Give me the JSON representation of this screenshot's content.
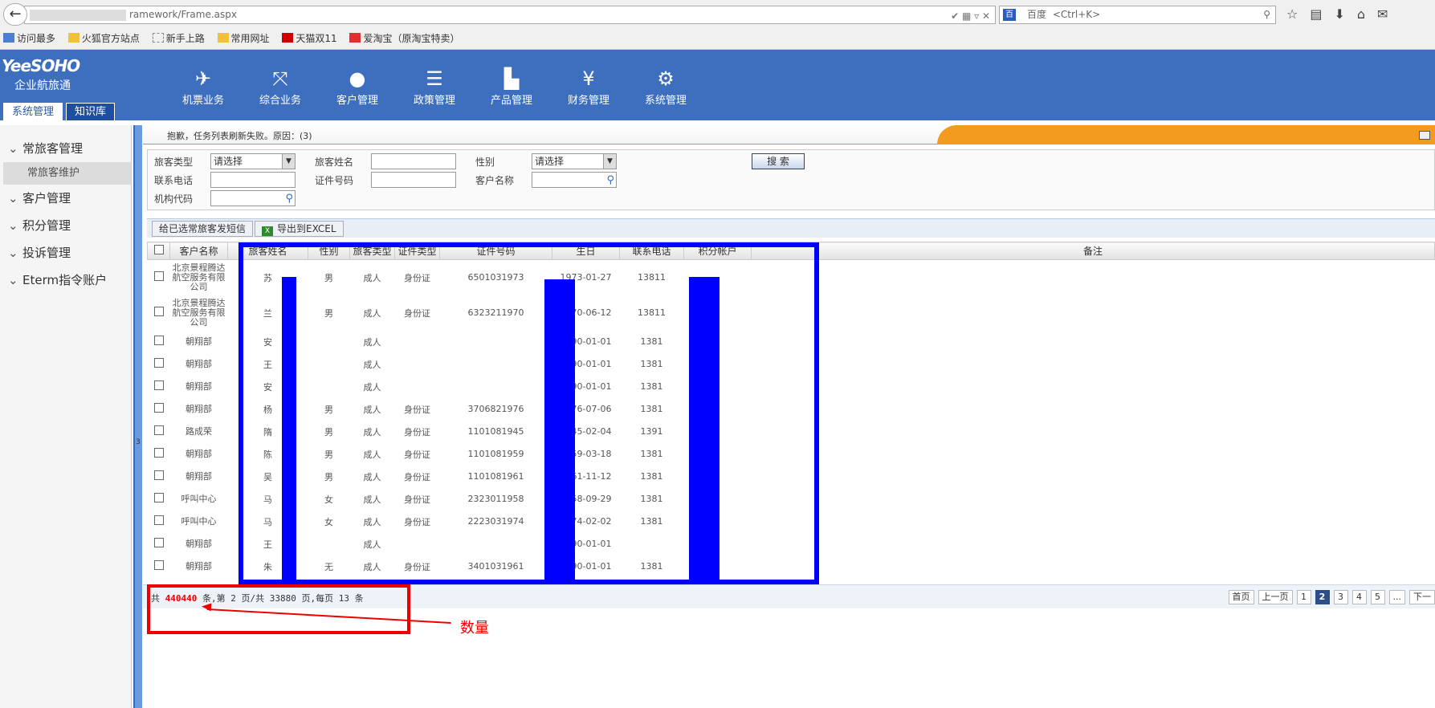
{
  "browser": {
    "url_text": "ramework/Frame.aspx",
    "search_engine": "百度",
    "search_placeholder": "<Ctrl+K>",
    "bookmarks": [
      "访问最多",
      "火狐官方站点",
      "新手上路",
      "常用网址",
      "天猫双11",
      "爱淘宝（原淘宝特卖）"
    ]
  },
  "app": {
    "brand_logo": "YeeSOHO",
    "brand_name": "企业航旅通",
    "nav": [
      {
        "label": "机票业务",
        "icon": "airplane-icon"
      },
      {
        "label": "综合业务",
        "icon": "branch-icon"
      },
      {
        "label": "客户管理",
        "icon": "user-icon"
      },
      {
        "label": "政策管理",
        "icon": "stack-icon"
      },
      {
        "label": "产品管理",
        "icon": "factory-icon"
      },
      {
        "label": "财务管理",
        "icon": "yen-icon"
      },
      {
        "label": "系统管理",
        "icon": "gear-icon"
      }
    ],
    "tabs": [
      "系统管理",
      "知识库"
    ]
  },
  "sidebar": {
    "items": [
      "常旅客管理",
      "客户管理",
      "积分管理",
      "投诉管理",
      "Eterm指令账户"
    ],
    "sub_item": "常旅客维护",
    "splitter_label": "3"
  },
  "message": "抱歉，任务列表刷新失败。原因：(3)",
  "filter": {
    "traveler_type_label": "旅客类型",
    "traveler_type_value": "请选择",
    "traveler_name_label": "旅客姓名",
    "gender_label": "性别",
    "gender_value": "请选择",
    "search_button": "搜 索",
    "phone_label": "联系电话",
    "id_number_label": "证件号码",
    "customer_name_label": "客户名称",
    "org_code_label": "机构代码"
  },
  "actions": {
    "sms_button": "给已选常旅客发短信",
    "export_button": "导出到EXCEL"
  },
  "table": {
    "headers": [
      "客户名称",
      "旅客姓名",
      "性别",
      "旅客类型",
      "证件类型",
      "证件号码",
      "生日",
      "联系电话",
      "积分帐户",
      "备注"
    ],
    "rows": [
      {
        "customer": "北京景程腾达航空服务有限公司",
        "name": "苏",
        "gender": "男",
        "type": "成人",
        "id_type": "身份证",
        "id_no": "6501031973",
        "birthday": "1973-01-27",
        "phone": "13811"
      },
      {
        "customer": "北京景程腾达航空服务有限公司",
        "name": "兰",
        "gender": "男",
        "type": "成人",
        "id_type": "身份证",
        "id_no": "6323211970",
        "birthday": "1970-06-12",
        "phone": "13811"
      },
      {
        "customer": "朝翔部",
        "name": "安",
        "gender": "",
        "type": "成人",
        "id_type": "",
        "id_no": "",
        "birthday": "1990-01-01",
        "phone": "1381"
      },
      {
        "customer": "朝翔部",
        "name": "王",
        "gender": "",
        "type": "成人",
        "id_type": "",
        "id_no": "",
        "birthday": "1990-01-01",
        "phone": "1381"
      },
      {
        "customer": "朝翔部",
        "name": "安",
        "gender": "",
        "type": "成人",
        "id_type": "",
        "id_no": "",
        "birthday": "1990-01-01",
        "phone": "1381"
      },
      {
        "customer": "朝翔部",
        "name": "杨",
        "gender": "男",
        "type": "成人",
        "id_type": "身份证",
        "id_no": "3706821976",
        "birthday": "1976-07-06",
        "phone": "1381"
      },
      {
        "customer": "路成荣",
        "name": "隋",
        "gender": "男",
        "type": "成人",
        "id_type": "身份证",
        "id_no": "1101081945",
        "birthday": "1945-02-04",
        "phone": "1391"
      },
      {
        "customer": "朝翔部",
        "name": "陈",
        "gender": "男",
        "type": "成人",
        "id_type": "身份证",
        "id_no": "1101081959",
        "birthday": "1959-03-18",
        "phone": "1381"
      },
      {
        "customer": "朝翔部",
        "name": "吴",
        "gender": "男",
        "type": "成人",
        "id_type": "身份证",
        "id_no": "1101081961",
        "birthday": "1961-11-12",
        "phone": "1381"
      },
      {
        "customer": "呼叫中心",
        "name": "马",
        "gender": "女",
        "type": "成人",
        "id_type": "身份证",
        "id_no": "2323011958",
        "birthday": "1958-09-29",
        "phone": "1381"
      },
      {
        "customer": "呼叫中心",
        "name": "马",
        "gender": "女",
        "type": "成人",
        "id_type": "身份证",
        "id_no": "2223031974",
        "birthday": "1974-02-02",
        "phone": "1381"
      },
      {
        "customer": "朝翔部",
        "name": "王",
        "gender": "",
        "type": "成人",
        "id_type": "",
        "id_no": "",
        "birthday": "1990-01-01",
        "phone": ""
      },
      {
        "customer": "朝翔部",
        "name": "朱",
        "gender": "无",
        "type": "成人",
        "id_type": "身份证",
        "id_no": "3401031961",
        "birthday": "1990-01-01",
        "phone": "1381"
      }
    ]
  },
  "footer": {
    "total_prefix": "共 ",
    "total_count": "440440",
    "total_suffix": " 条,第 2 页/共 33880 页,每页 13 条",
    "pager": [
      "首页",
      "上一页",
      "1",
      "2",
      "3",
      "4",
      "5",
      "...",
      "下一"
    ],
    "current_page": "2"
  },
  "annotation": {
    "label": "数量",
    "color": "#ee0000",
    "highlight_color": "#0000ff"
  }
}
